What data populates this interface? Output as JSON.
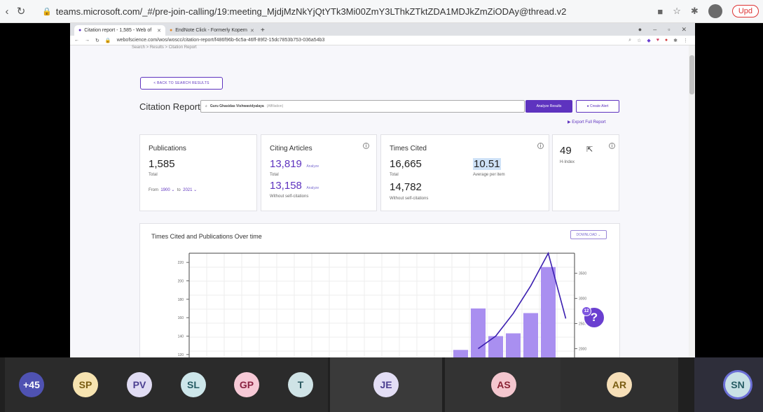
{
  "outer_browser": {
    "url": "teams.microsoft.com/_#/pre-join-calling/19:meeting_MjdjMzNkYjQtYTk3Mi00ZmY3LThkZTktZDA1MDJkZmZiODAy@thread.v2",
    "update_label": "Upd"
  },
  "inner_browser": {
    "tabs": [
      {
        "label": "Citation report - 1,585 - Web of"
      },
      {
        "label": "EndNote Click - Formerly Kopern"
      }
    ],
    "url": "webofscience.com/wos/woscc/citation-report/f486f96b-6c5a-46ff-89f2-15dc7853b753-036a54b3"
  },
  "page": {
    "breadcrumb": "Search > Results > Citation Report",
    "back_label": "< BACK TO SEARCH RESULTS",
    "title": "Citation Report",
    "search_query": "Guru Ghasidas Vishwavidyalaya",
    "search_hint": "(Affiliation)",
    "analyze_results": "Analyze Results",
    "create_alert": "Create Alert",
    "export": "Export Full Report"
  },
  "metrics": {
    "publications": {
      "label": "Publications",
      "value": "1,585",
      "sub": "Total",
      "from_label": "From",
      "from": "1900",
      "to_label": "to",
      "to": "2021"
    },
    "citing": {
      "label": "Citing Articles",
      "total": "13,819",
      "total_sub": "Total",
      "without": "13,158",
      "without_sub": "Without self-citations",
      "analyze": "Analyze"
    },
    "times_cited": {
      "label": "Times Cited",
      "total": "16,665",
      "total_sub": "Total",
      "avg": "10.51",
      "avg_sub": "Average per item",
      "without": "14,782",
      "without_sub": "Without self-citations"
    },
    "h_index": {
      "value": "49",
      "sub": "H-Index"
    }
  },
  "chart_data": {
    "type": "bar",
    "title": "Times Cited and Publications Over time",
    "download_label": "DOWNLOAD",
    "left_axis_ticks": [
      "220",
      "200",
      "180",
      "160",
      "140",
      "120"
    ],
    "right_axis_ticks": [
      "3500",
      "3000",
      "2500",
      "2000"
    ],
    "publications_bars": [
      115,
      125,
      170,
      140,
      143,
      165,
      215,
      108
    ],
    "times_cited_line": [
      2000,
      2250,
      2700,
      3250,
      3900,
      2600
    ]
  },
  "help": {
    "symbol": "?",
    "badge": "12"
  },
  "participants": [
    {
      "initials": "+45",
      "color": "#4f52b2",
      "text": "#ffffff"
    },
    {
      "initials": "SP",
      "color": "#f6e3b0",
      "text": "#7a5d13"
    },
    {
      "initials": "PV",
      "color": "#e0dcf3",
      "text": "#4b3f91"
    },
    {
      "initials": "SL",
      "color": "#cde6ea",
      "text": "#275d65"
    },
    {
      "initials": "GP",
      "color": "#f6c9d6",
      "text": "#8a2342"
    },
    {
      "initials": "T",
      "color": "#cfe3e6",
      "text": "#2b5a61"
    },
    {
      "initials": "JE",
      "color": "#e3def5",
      "text": "#4b3f91"
    },
    {
      "initials": "AS",
      "color": "#f4c7cf",
      "text": "#8a2334"
    },
    {
      "initials": "AR",
      "color": "#f6dfb8",
      "text": "#7a5d13"
    },
    {
      "initials": "SN",
      "color": "#c9e1e6",
      "text": "#275d65"
    }
  ]
}
